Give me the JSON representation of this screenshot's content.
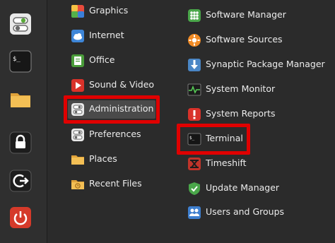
{
  "favorites": [
    {
      "name": "Software Manager",
      "icon": "toggle-switches-icon"
    },
    {
      "name": "Terminal",
      "icon": "terminal-icon"
    },
    {
      "name": "Files",
      "icon": "folder-icon"
    },
    {
      "name": "Lock Screen",
      "icon": "lock-icon"
    },
    {
      "name": "Log Out",
      "icon": "logout-icon"
    },
    {
      "name": "Quit",
      "icon": "power-icon"
    }
  ],
  "categories": [
    {
      "label": "Graphics",
      "icon": "graphics-icon"
    },
    {
      "label": "Internet",
      "icon": "cloud-icon"
    },
    {
      "label": "Office",
      "icon": "office-icon"
    },
    {
      "label": "Sound & Video",
      "icon": "play-icon"
    },
    {
      "label": "Administration",
      "icon": "toggle-switches-icon",
      "selected": true
    },
    {
      "label": "Preferences",
      "icon": "toggle-switches-icon"
    },
    {
      "label": "Places",
      "icon": "folder-icon"
    },
    {
      "label": "Recent Files",
      "icon": "recent-folder-icon"
    }
  ],
  "apps": [
    {
      "label": "Software Manager",
      "icon": "software-manager-icon"
    },
    {
      "label": "Software Sources",
      "icon": "software-sources-icon"
    },
    {
      "label": "Synaptic Package Manager",
      "icon": "download-icon"
    },
    {
      "label": "System Monitor",
      "icon": "monitor-icon"
    },
    {
      "label": "System Reports",
      "icon": "warning-icon"
    },
    {
      "label": "Terminal",
      "icon": "terminal-icon",
      "highlighted": true
    },
    {
      "label": "Timeshift",
      "icon": "timeshift-icon"
    },
    {
      "label": "Update Manager",
      "icon": "shield-icon"
    },
    {
      "label": "Users and Groups",
      "icon": "users-icon"
    }
  ],
  "colors": {
    "background": "#2b2b2b",
    "highlight": "#e00000",
    "selected": "#4a4a4a",
    "accent": "#4caf50"
  }
}
